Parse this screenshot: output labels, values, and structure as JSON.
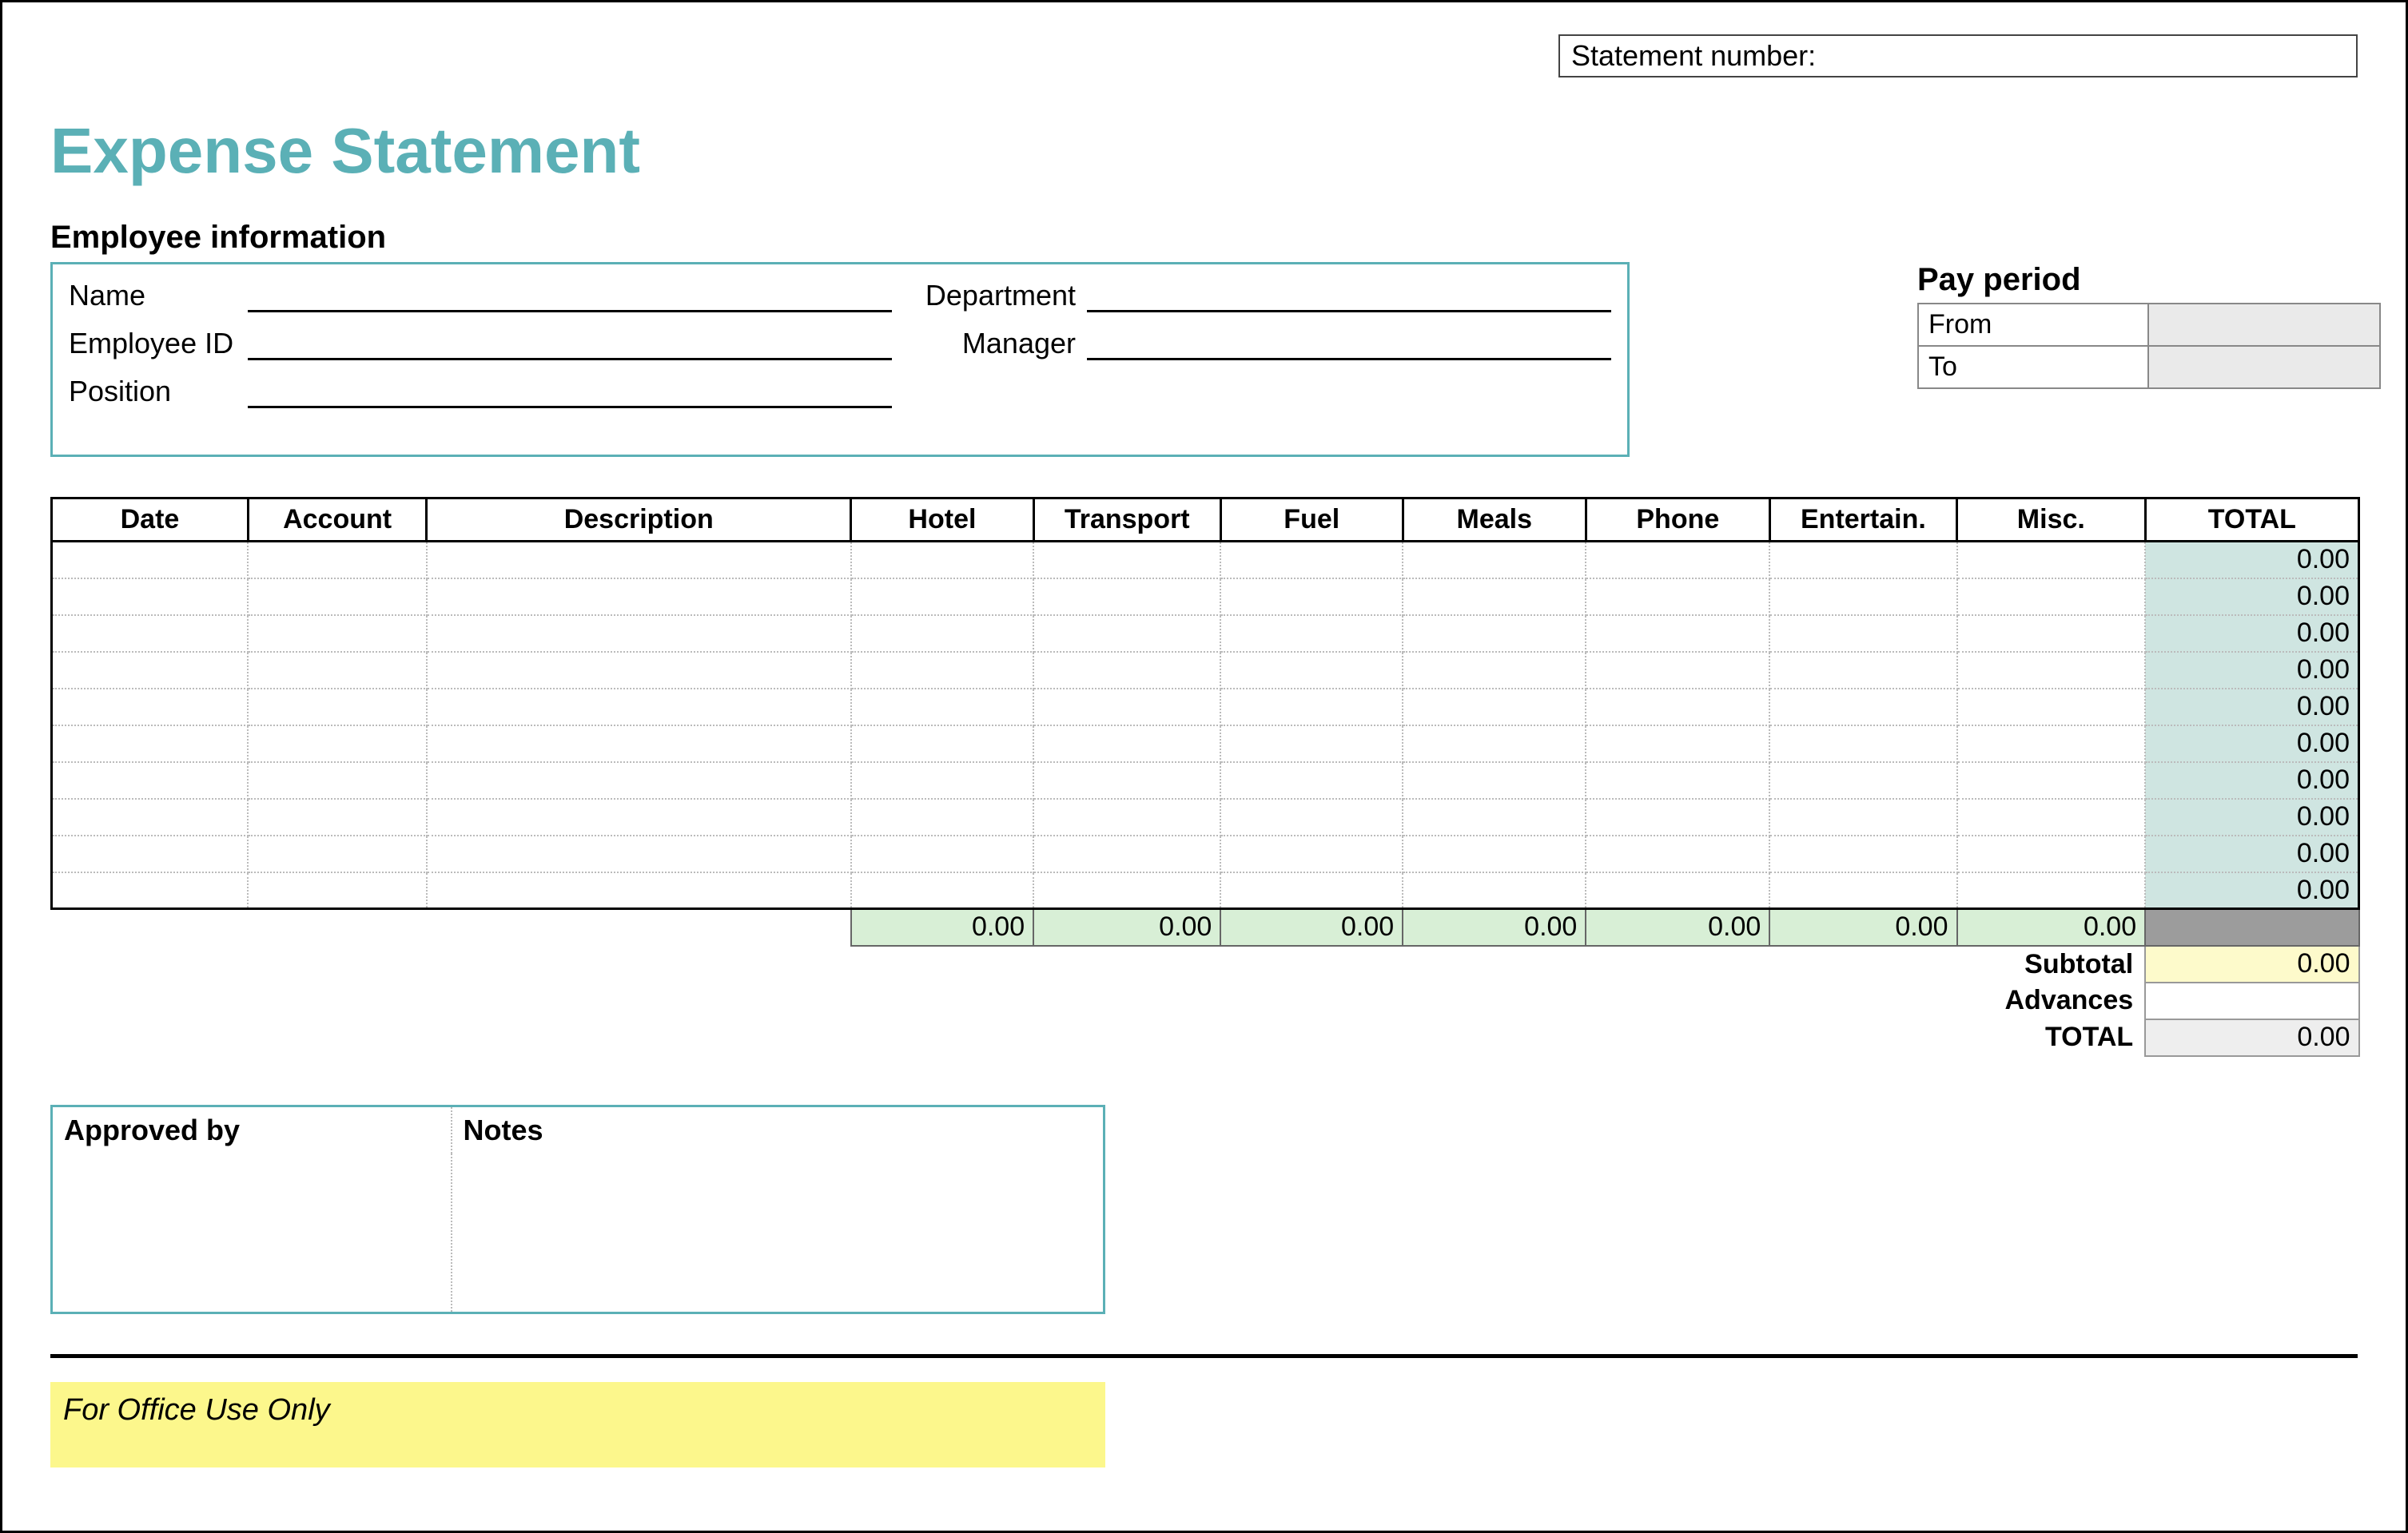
{
  "statement_number": {
    "label": "Statement number:",
    "value": ""
  },
  "title": "Expense Statement",
  "employee_section": {
    "heading": "Employee information",
    "fields": {
      "name_label": "Name",
      "employee_id_label": "Employee ID",
      "position_label": "Position",
      "department_label": "Department",
      "manager_label": "Manager",
      "name_value": "",
      "employee_id_value": "",
      "position_value": "",
      "department_value": "",
      "manager_value": ""
    }
  },
  "pay_period": {
    "heading": "Pay period",
    "from_label": "From",
    "to_label": "To",
    "from_value": "",
    "to_value": ""
  },
  "columns": {
    "date": "Date",
    "account": "Account",
    "description": "Description",
    "hotel": "Hotel",
    "transport": "Transport",
    "fuel": "Fuel",
    "meals": "Meals",
    "phone": "Phone",
    "entertain": "Entertain.",
    "misc": "Misc.",
    "total": "TOTAL"
  },
  "rows": [
    {
      "total": "0.00"
    },
    {
      "total": "0.00"
    },
    {
      "total": "0.00"
    },
    {
      "total": "0.00"
    },
    {
      "total": "0.00"
    },
    {
      "total": "0.00"
    },
    {
      "total": "0.00"
    },
    {
      "total": "0.00"
    },
    {
      "total": "0.00"
    },
    {
      "total": "0.00"
    }
  ],
  "column_sums": {
    "hotel": "0.00",
    "transport": "0.00",
    "fuel": "0.00",
    "meals": "0.00",
    "phone": "0.00",
    "entertain": "0.00",
    "misc": "0.00"
  },
  "summary": {
    "subtotal_label": "Subtotal",
    "subtotal_value": "0.00",
    "advances_label": "Advances",
    "advances_value": "",
    "total_label": "TOTAL",
    "total_value": "0.00"
  },
  "approval": {
    "approved_by_label": "Approved by",
    "notes_label": "Notes"
  },
  "office_only_label": "For Office Use Only"
}
